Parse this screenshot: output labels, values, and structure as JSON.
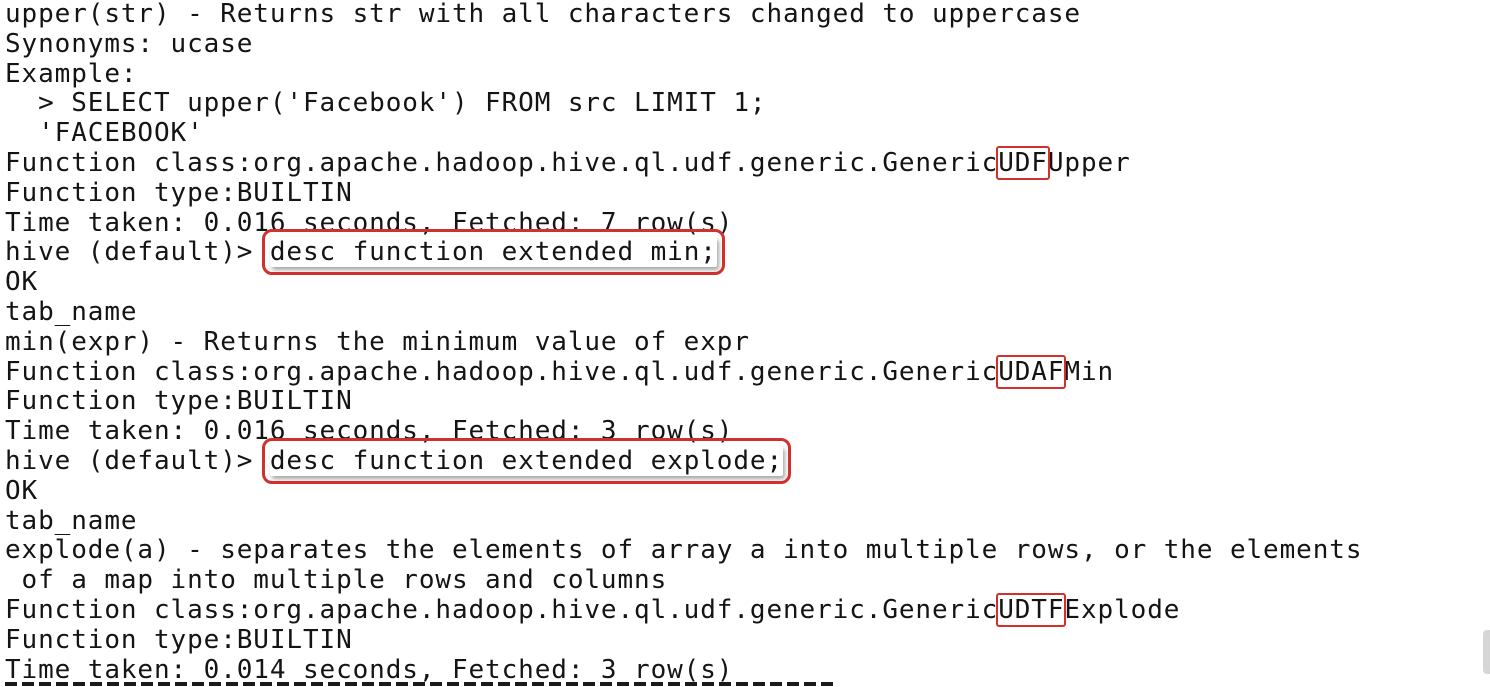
{
  "terminal": {
    "lines": {
      "l01": "upper(str) - Returns str with all characters changed to uppercase",
      "l02": "Synonyms: ucase",
      "l03": "Example:",
      "l04": "  > SELECT upper('Facebook') FROM src LIMIT 1;",
      "l05": "  'FACEBOOK'",
      "l06_prefix": "Function class:org.apache.hadoop.hive.ql.udf.generic.Generic",
      "l06_mark": "UDF",
      "l06_suffix": "Upper",
      "l07": "Function type:BUILTIN",
      "l08": "Time taken: 0.016 seconds, Fetched: 7 row(s)",
      "l09_prompt": "hive (default)> ",
      "l09_cmd": "desc function extended min;",
      "l10": "OK",
      "l11": "tab_name",
      "l12": "min(expr) - Returns the minimum value of expr",
      "l13_prefix": "Function class:org.apache.hadoop.hive.ql.udf.generic.Generic",
      "l13_mark": "UDAF",
      "l13_suffix": "Min",
      "l14": "Function type:BUILTIN",
      "l15": "Time taken: 0.016 seconds, Fetched: 3 row(s)",
      "l16_prompt": "hive (default)> ",
      "l16_cmd": "desc function extended explode;",
      "l17": "OK",
      "l18": "tab_name",
      "l19": "explode(a) - separates the elements of array a into multiple rows, or the elements",
      "l20": " of a map into multiple rows and columns",
      "l21_prefix": "Function class:org.apache.hadoop.hive.ql.udf.generic.Generic",
      "l21_mark": "UDTF",
      "l21_suffix": "Explode",
      "l22": "Function type:BUILTIN",
      "l23": "Time taken: 0.014 seconds, Fetched: 3 row(s)"
    }
  },
  "colors": {
    "background": "#ffffff",
    "text": "#141414",
    "highlight": "#d0312d"
  }
}
